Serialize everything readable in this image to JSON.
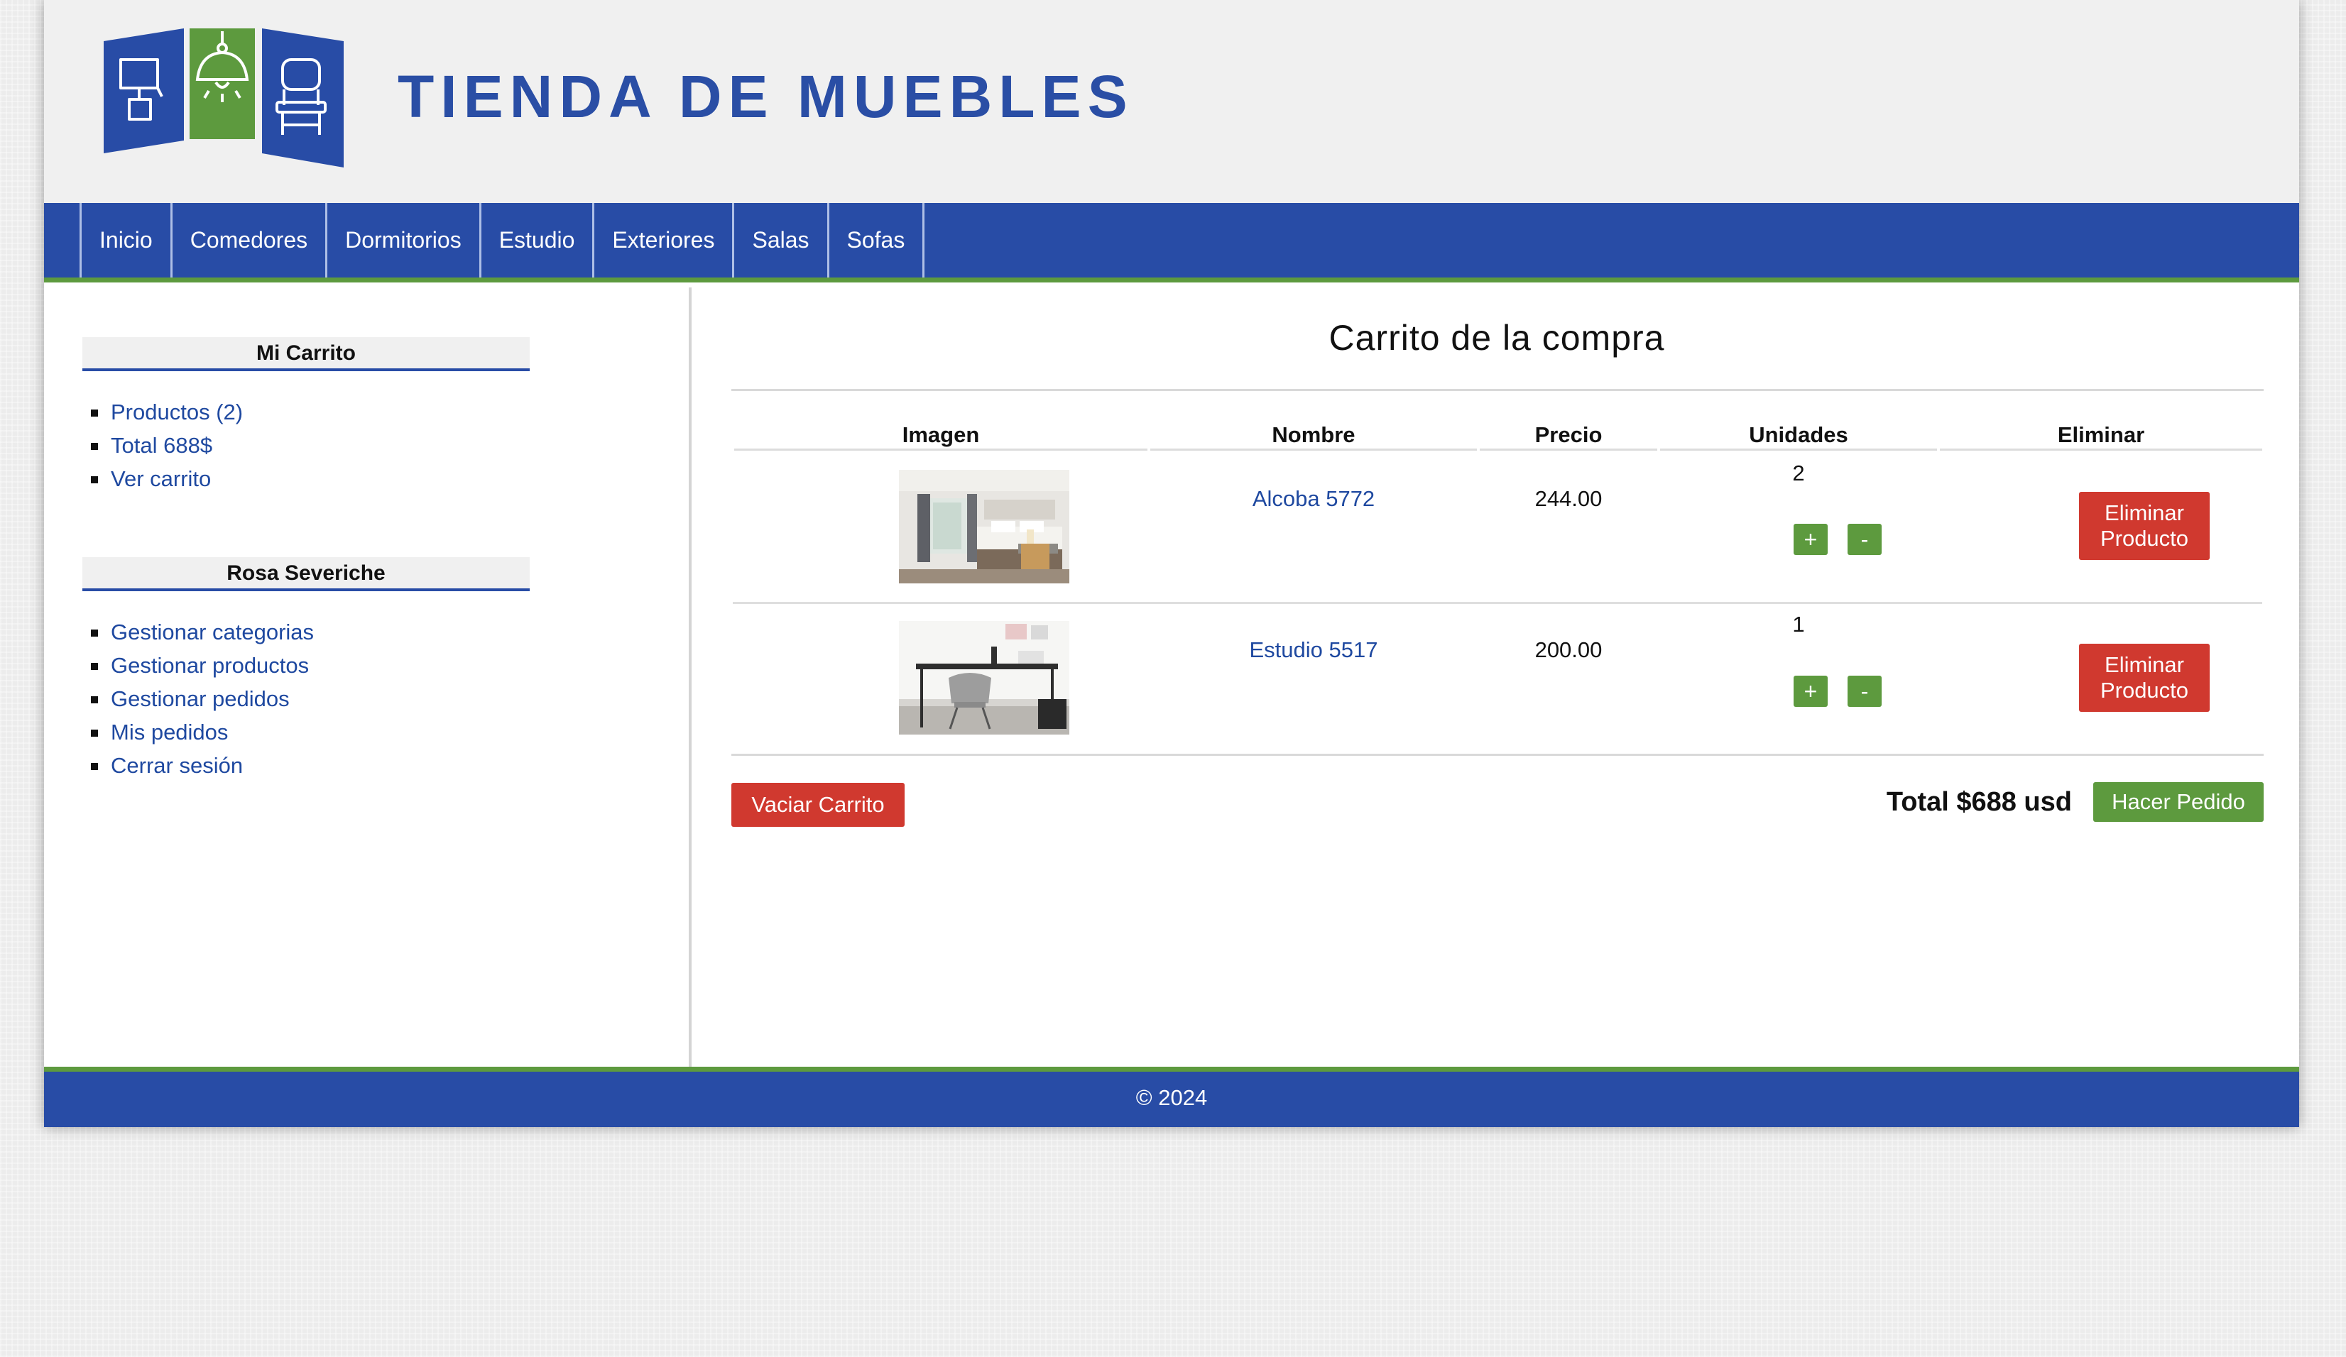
{
  "header": {
    "title": "TIENDA DE MUEBLES"
  },
  "nav": {
    "items": [
      "Inicio",
      "Comedores",
      "Dormitorios",
      "Estudio",
      "Exteriores",
      "Salas",
      "Sofas"
    ]
  },
  "sidebar": {
    "cart": {
      "title": "Mi Carrito",
      "items": [
        "Productos (2)",
        "Total 688$",
        "Ver carrito"
      ]
    },
    "user": {
      "title": "Rosa Severiche",
      "items": [
        "Gestionar categorias",
        "Gestionar productos",
        "Gestionar pedidos",
        "Mis pedidos",
        "Cerrar sesión"
      ]
    }
  },
  "main": {
    "title": "Carrito de la compra",
    "columns": [
      "Imagen",
      "Nombre",
      "Precio",
      "Unidades",
      "Eliminar"
    ],
    "rows": [
      {
        "image": "bedroom-photo",
        "name": "Alcoba 5772",
        "price": "244.00",
        "units": "2",
        "plus": "+",
        "minus": "-",
        "remove_line1": "Eliminar",
        "remove_line2": "Producto"
      },
      {
        "image": "study-desk-photo",
        "name": "Estudio 5517",
        "price": "200.00",
        "units": "1",
        "plus": "+",
        "minus": "-",
        "remove_line1": "Eliminar",
        "remove_line2": "Producto"
      }
    ],
    "empty_cart_label": "Vaciar Carrito",
    "total_label": "Total $688 usd",
    "order_label": "Hacer Pedido"
  },
  "footer": {
    "text": "© 2024"
  },
  "colors": {
    "primary_blue": "#284ca6",
    "accent_green": "#5d9a3e",
    "danger_red": "#d0392f",
    "link_blue": "#1f49a0"
  }
}
